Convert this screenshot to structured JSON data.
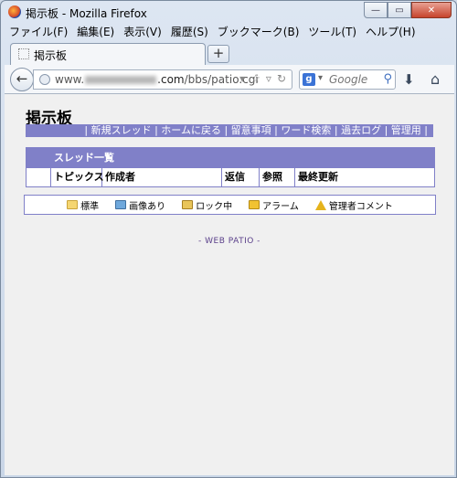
{
  "window": {
    "title": "掲示板 - Mozilla Firefox",
    "buttons": {
      "minimize": "—",
      "maximize": "▭",
      "close": "✕"
    }
  },
  "menubar": [
    "ファイル(F)",
    "編集(E)",
    "表示(V)",
    "履歴(S)",
    "ブックマーク(B)",
    "ツール(T)",
    "ヘルプ(H)"
  ],
  "tabs": [
    {
      "label": "掲示板"
    }
  ],
  "newtab_label": "+",
  "address": {
    "prefix": "www.",
    "host_suffix": ".com",
    "path": "/bbs/patio.cgi"
  },
  "search": {
    "engine": "g",
    "placeholder": "Google"
  },
  "page": {
    "title": "掲示板",
    "nav_links": [
      "新規スレッド",
      "ホームに戻る",
      "留意事項",
      "ワード検索",
      "過去ログ",
      "管理用"
    ],
    "thread_list": {
      "heading": "スレッド一覧",
      "columns": [
        "",
        "トピックス",
        "作成者",
        "返信",
        "参照",
        "最終更新"
      ]
    },
    "legend": [
      {
        "icon": "folder",
        "label": "標準"
      },
      {
        "icon": "image",
        "label": "画像あり"
      },
      {
        "icon": "lock",
        "label": "ロック中"
      },
      {
        "icon": "alarm",
        "label": "アラーム"
      },
      {
        "icon": "warn",
        "label": "管理者コメント"
      }
    ],
    "footer": "- WEB PATIO -"
  }
}
